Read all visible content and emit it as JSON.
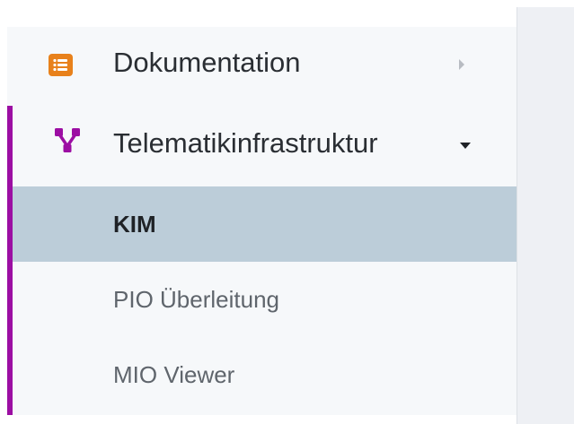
{
  "sidebar": {
    "items": [
      {
        "label": "Dokumentation",
        "icon": "list-icon",
        "icon_color": "#e8811b",
        "indicator": "arrow-right"
      },
      {
        "label": "Telematikinfrastruktur",
        "icon": "network-icon",
        "icon_color": "#9c0ea3",
        "indicator": "caret-down",
        "expanded": true,
        "children": [
          {
            "label": "KIM",
            "selected": true
          },
          {
            "label": "PIO Überleitung",
            "selected": false
          },
          {
            "label": "MIO Viewer",
            "selected": false
          }
        ]
      }
    ],
    "accent_color": "#9c0ea3",
    "selected_background": "#bccdd9"
  }
}
